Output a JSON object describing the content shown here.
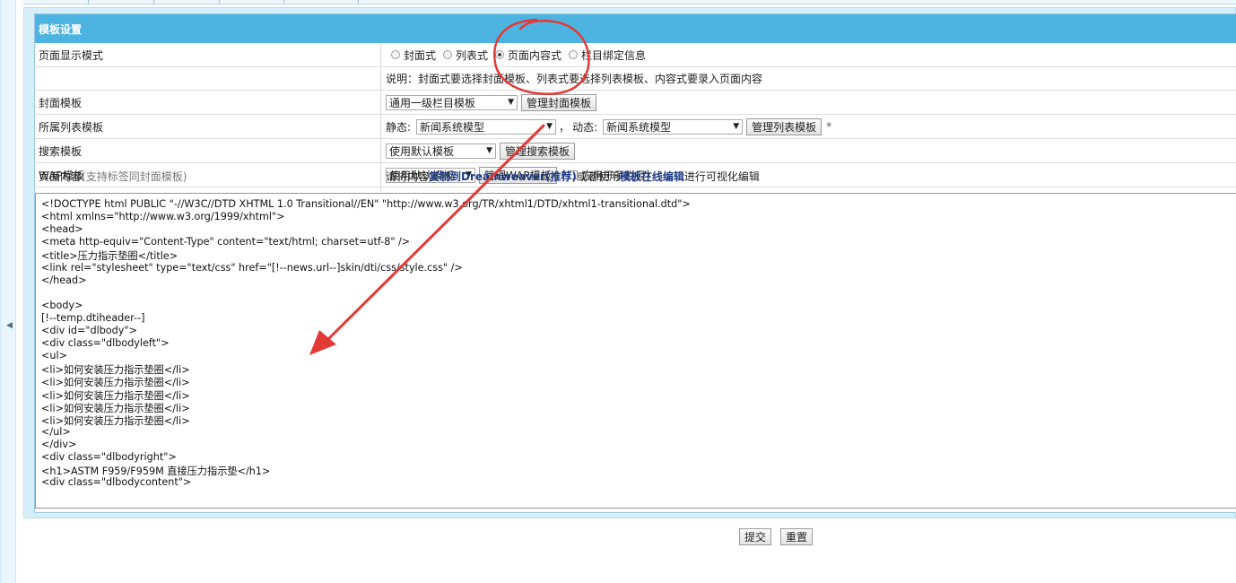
{
  "panel": {
    "header_title": "模板设置"
  },
  "rows": {
    "display_mode": {
      "label": "页面显示模式",
      "options": [
        "封面式",
        "列表式",
        "页面内容式",
        "栏目绑定信息"
      ],
      "selected": "页面内容式"
    },
    "note": {
      "text": "说明：封面式要选择封面模板、列表式要选择列表模板、内容式要录入页面内容"
    },
    "cover_template": {
      "label": "封面模板",
      "select_value": "通用一级栏目模板",
      "button": "管理封面模板"
    },
    "list_template": {
      "label": "所属列表模板",
      "static_label": "静态:",
      "static_value": "新闻系统模型",
      "separator": "，",
      "dynamic_label": "动态:",
      "dynamic_value": "新闻系统模型",
      "button": "管理列表模板",
      "required_mark": "*"
    },
    "search_template": {
      "label": "搜索模板",
      "select_value": "使用默认模板",
      "button": "管理搜索模板"
    },
    "wap_template": {
      "label": "WAP模板",
      "select_value": "使用默认模板",
      "button": "管理WAP模板",
      "paren_open": "(",
      "checkbox_label": "应用于子栏目",
      "paren_close": ")"
    },
    "page_content": {
      "label": "页面内容",
      "label_hint": "(支持标签同封面模板)",
      "hint_prefix": "请将内容",
      "hint_link1": "复制到Dreamweaver(推荐)",
      "hint_mid": "或者使用",
      "hint_link2": "模板在线编辑",
      "hint_suffix": "进行可视化编辑"
    }
  },
  "code_lines": [
    "<!DOCTYPE html PUBLIC \"-//W3C//DTD XHTML 1.0 Transitional//EN\" \"http://www.w3.org/TR/xhtml1/DTD/xhtml1-transitional.dtd\">",
    "<html xmlns=\"http://www.w3.org/1999/xhtml\">",
    "<head>",
    "<meta http-equiv=\"Content-Type\" content=\"text/html; charset=utf-8\" />",
    "<title>压力指示垫圈</title>",
    "<link rel=\"stylesheet\" type=\"text/css\" href=\"[!--news.url--]skin/dti/css/style.css\" />",
    "</head>",
    "",
    "<body>",
    "[!--temp.dtiheader--]",
    "<div id=\"dlbody\">",
    "<div class=\"dlbodyleft\">",
    "<ul>",
    "<li>如何安装压力指示垫圈</li>",
    "<li>如何安装压力指示垫圈</li>",
    "<li>如何安装压力指示垫圈</li>",
    "<li>如何安装压力指示垫圈</li>",
    "<li>如何安装压力指示垫圈</li>",
    "</ul>",
    "</div>",
    "<div class=\"dlbodyright\">",
    "<h1>ASTM F959/F959M 直接压力指示垫</h1>",
    "<div class=\"dlbodycontent\">"
  ],
  "buttons": {
    "submit": "提交",
    "reset": "重置"
  },
  "icons": {
    "collapse": "chevron-left-icon",
    "dropdown": "triangle-down-icon"
  },
  "colors": {
    "header_bg": "#4db3e0",
    "panel_bg": "#d6eef9",
    "annotation_red": "#e23a36"
  }
}
